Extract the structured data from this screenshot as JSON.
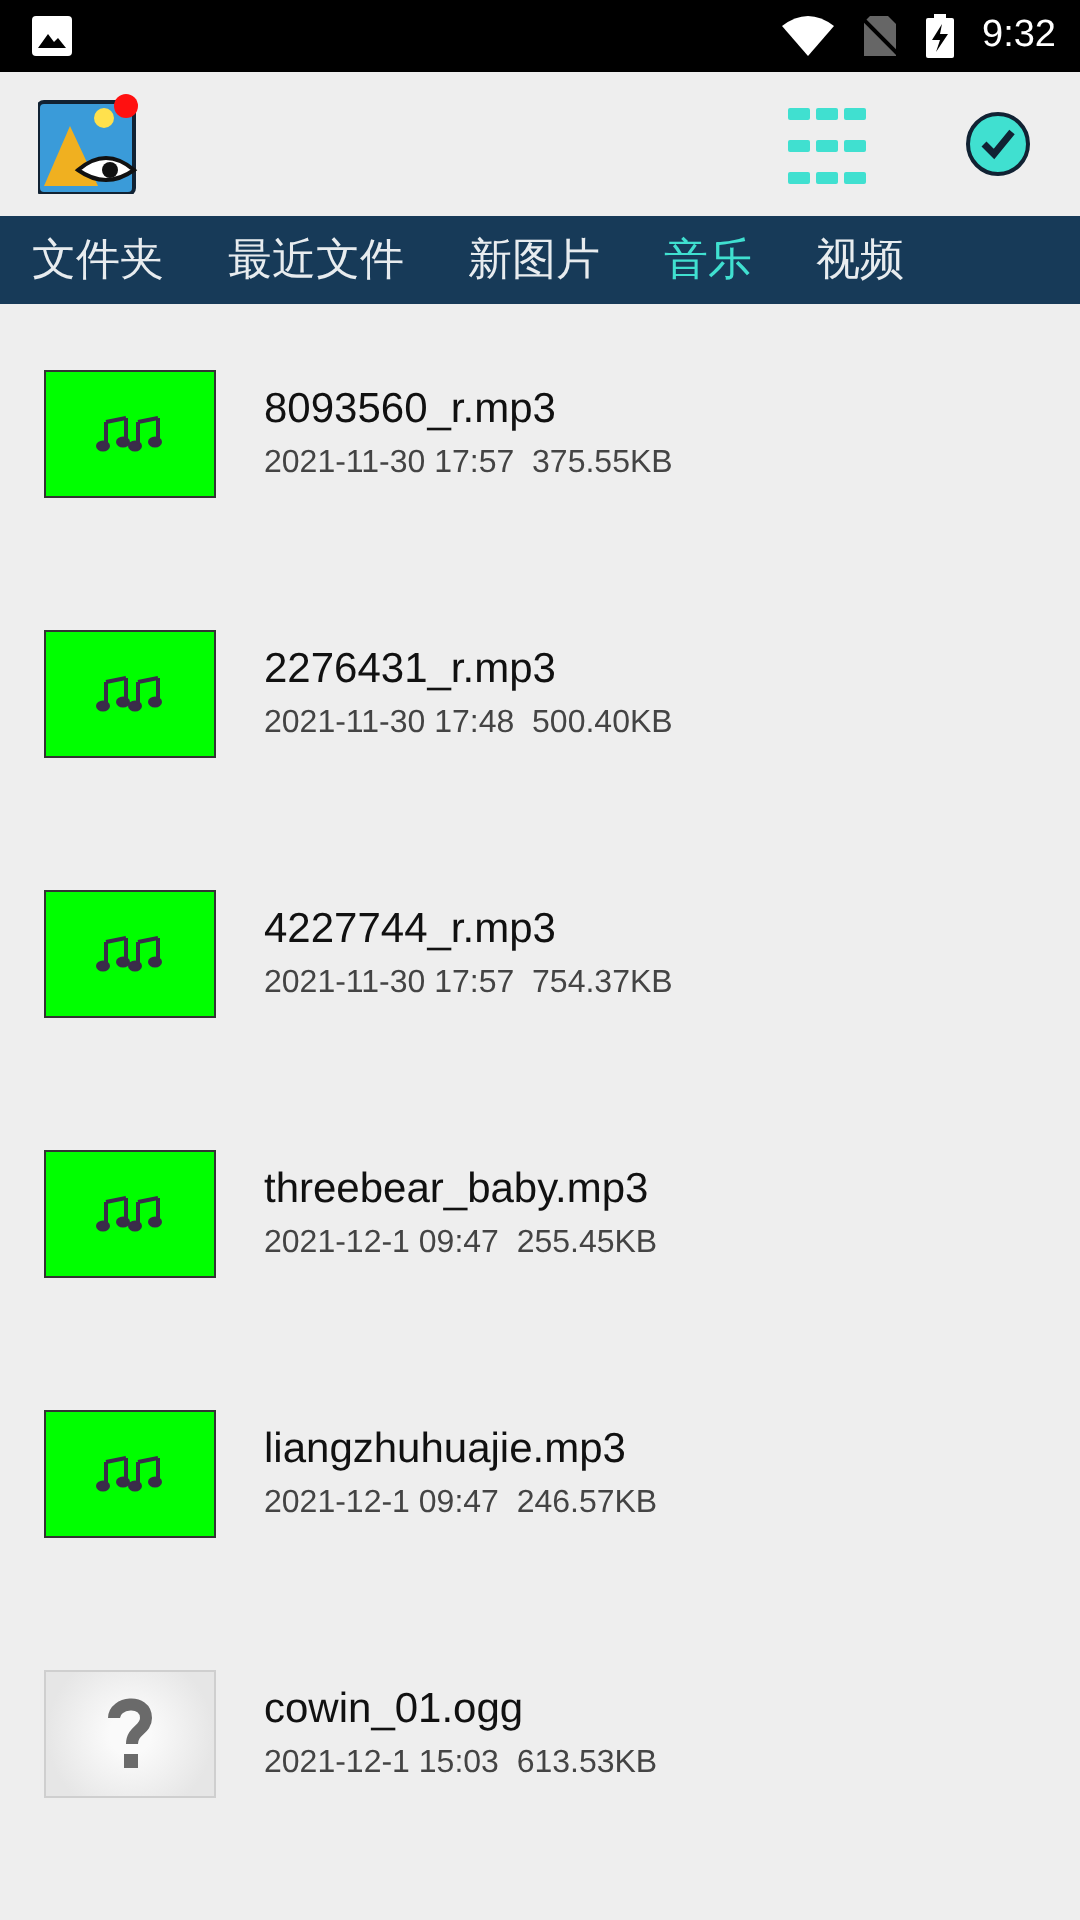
{
  "status_bar": {
    "time": "9:32"
  },
  "tabs": [
    {
      "label": "文件夹",
      "selected": false
    },
    {
      "label": "最近文件",
      "selected": false
    },
    {
      "label": "新图片",
      "selected": false
    },
    {
      "label": "音乐",
      "selected": true
    },
    {
      "label": "视频",
      "selected": false
    }
  ],
  "files": [
    {
      "kind": "audio",
      "name": "8093560_r.mp3",
      "date": "2021-11-30 17:57",
      "size": "375.55KB"
    },
    {
      "kind": "audio",
      "name": "2276431_r.mp3",
      "date": "2021-11-30 17:48",
      "size": "500.40KB"
    },
    {
      "kind": "audio",
      "name": "4227744_r.mp3",
      "date": "2021-11-30 17:57",
      "size": "754.37KB"
    },
    {
      "kind": "audio",
      "name": "threebear_baby.mp3",
      "date": "2021-12-1 09:47",
      "size": "255.45KB"
    },
    {
      "kind": "audio",
      "name": "liangzhuhuajie.mp3",
      "date": "2021-12-1 09:47",
      "size": "246.57KB"
    },
    {
      "kind": "unknown",
      "name": "cowin_01.ogg",
      "date": "2021-12-1 15:03",
      "size": "613.53KB"
    }
  ]
}
